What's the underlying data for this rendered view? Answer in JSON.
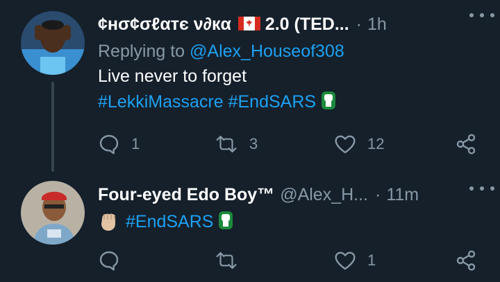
{
  "tweets": [
    {
      "display_name": "¢нσ¢σℓαтє ν∂кα",
      "name_suffix": "2.0 (TED...",
      "time": "1h",
      "replying_prefix": "Replying to ",
      "replying_handle": "@Alex_Houseof308",
      "text_line": "Live never to forget",
      "hashtags": [
        "#LekkiMassacre",
        "#EndSARS"
      ],
      "actions": {
        "replies": "1",
        "retweets": "3",
        "likes": "12"
      }
    },
    {
      "display_name": "Four-eyed Edo Boy™",
      "handle": "@Alex_H...",
      "time": "11m",
      "hashtags": [
        "#EndSARS"
      ],
      "actions": {
        "replies": "",
        "retweets": "",
        "likes": "1"
      }
    }
  ],
  "icons": {
    "reply": "reply-icon",
    "retweet": "retweet-icon",
    "like": "heart-icon",
    "share": "share-icon",
    "more": "more-icon",
    "flag": "canada-flag-icon",
    "fist": "endsars-fist-icon",
    "raised_fist": "raised-fist-emoji-icon"
  },
  "colors": {
    "background": "#15202b",
    "link": "#1da1f2",
    "muted": "#8899a6",
    "text": "#ffffff",
    "fist_green": "#1b8a3c"
  }
}
